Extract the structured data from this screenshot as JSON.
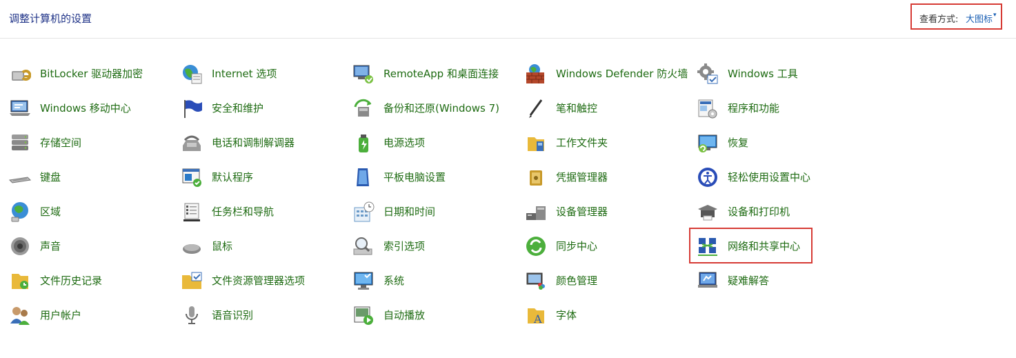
{
  "header": {
    "title": "调整计算机的设置",
    "view_by_label": "查看方式:",
    "view_by_value": "大图标",
    "view_by_arrow": "▾"
  },
  "items": [
    {
      "label": "BitLocker 驱动器加密",
      "icon": "bitlocker-icon"
    },
    {
      "label": "Internet 选项",
      "icon": "internet-options-icon"
    },
    {
      "label": "RemoteApp 和桌面连接",
      "icon": "remoteapp-icon"
    },
    {
      "label": "Windows Defender 防火墙",
      "icon": "firewall-icon"
    },
    {
      "label": "Windows 工具",
      "icon": "windows-tools-icon"
    },
    {
      "label": "Windows 移动中心",
      "icon": "mobility-center-icon"
    },
    {
      "label": "安全和维护",
      "icon": "security-maintenance-icon"
    },
    {
      "label": "备份和还原(Windows 7)",
      "icon": "backup-restore-icon"
    },
    {
      "label": "笔和触控",
      "icon": "pen-touch-icon"
    },
    {
      "label": "程序和功能",
      "icon": "programs-features-icon"
    },
    {
      "label": "存储空间",
      "icon": "storage-spaces-icon"
    },
    {
      "label": "电话和调制解调器",
      "icon": "phone-modem-icon"
    },
    {
      "label": "电源选项",
      "icon": "power-options-icon"
    },
    {
      "label": "工作文件夹",
      "icon": "work-folders-icon"
    },
    {
      "label": "恢复",
      "icon": "recovery-icon"
    },
    {
      "label": "键盘",
      "icon": "keyboard-icon"
    },
    {
      "label": "默认程序",
      "icon": "default-programs-icon"
    },
    {
      "label": "平板电脑设置",
      "icon": "tablet-settings-icon"
    },
    {
      "label": "凭据管理器",
      "icon": "credential-manager-icon"
    },
    {
      "label": "轻松使用设置中心",
      "icon": "ease-of-access-icon"
    },
    {
      "label": "区域",
      "icon": "region-icon"
    },
    {
      "label": "任务栏和导航",
      "icon": "taskbar-navigation-icon"
    },
    {
      "label": "日期和时间",
      "icon": "date-time-icon"
    },
    {
      "label": "设备管理器",
      "icon": "device-manager-icon"
    },
    {
      "label": "设备和打印机",
      "icon": "devices-printers-icon"
    },
    {
      "label": "声音",
      "icon": "sound-icon"
    },
    {
      "label": "鼠标",
      "icon": "mouse-icon"
    },
    {
      "label": "索引选项",
      "icon": "indexing-options-icon"
    },
    {
      "label": "同步中心",
      "icon": "sync-center-icon"
    },
    {
      "label": "网络和共享中心",
      "icon": "network-sharing-icon"
    },
    {
      "label": "文件历史记录",
      "icon": "file-history-icon"
    },
    {
      "label": "文件资源管理器选项",
      "icon": "file-explorer-options-icon"
    },
    {
      "label": "系统",
      "icon": "system-icon"
    },
    {
      "label": "颜色管理",
      "icon": "color-management-icon"
    },
    {
      "label": "疑难解答",
      "icon": "troubleshooting-icon"
    },
    {
      "label": "用户帐户",
      "icon": "user-accounts-icon"
    },
    {
      "label": "语音识别",
      "icon": "speech-recognition-icon"
    },
    {
      "label": "自动播放",
      "icon": "autoplay-icon"
    },
    {
      "label": "字体",
      "icon": "fonts-icon"
    }
  ],
  "highlighted_item": "网络和共享中心",
  "colors": {
    "link_green": "#1e6b12",
    "title_blue": "#1e3287",
    "highlight_red": "#d63a34"
  }
}
